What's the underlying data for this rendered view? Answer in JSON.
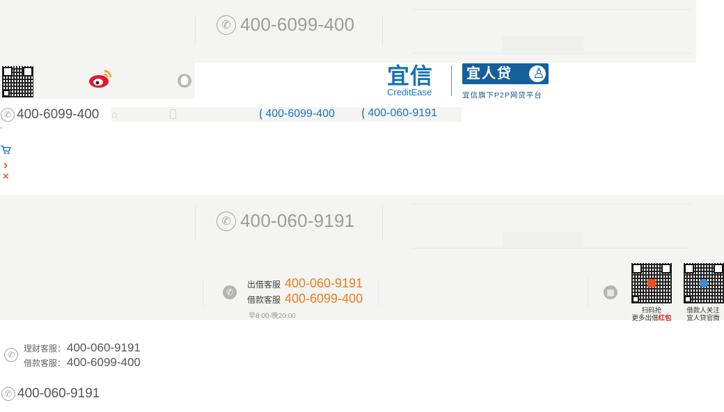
{
  "top_section": {
    "phone": "400-6099-400"
  },
  "social": {
    "qr_icon": "qr-code-icon",
    "weibo_icon": "weibo-icon",
    "qq_icon": "qq-icon"
  },
  "brand": {
    "creditease_cn": "宜信",
    "creditease_en": "CreditEase",
    "yirendai_name": "宜人贷",
    "yirendai_tagline": "宜信旗下P2P网贷平台"
  },
  "row3": {
    "phone_left": "400-6099-400",
    "phone_blue_1": "400-6099-400",
    "phone_blue_2": "400-060-9191"
  },
  "glyphs": {
    "cart": "🛒",
    "chevron": "›",
    "close": "×",
    "caret": "ˇ"
  },
  "middle_section": {
    "phone": "400-060-9191"
  },
  "service": {
    "lend_label": "出借客服",
    "lend_phone": "400-060-9191",
    "loan_label": "借款客服",
    "loan_phone": "400-6099-400",
    "hours": "早8:00-晚20:00",
    "qr1_caption_line1": "扫码抢",
    "qr1_caption_line2_pre": "更多出借",
    "qr1_caption_line2_red": "红包",
    "qr2_caption_line1": "借款人关注",
    "qr2_caption_line2": "宜人贷官微"
  },
  "footer_lines": {
    "finance_label": "理财客服：",
    "finance_phone": "400-060-9191",
    "loan_label": "借款客服：",
    "loan_phone": "400-6099-400",
    "single_phone": "400-060-9191"
  },
  "colors": {
    "brand_blue": "#1473bb",
    "accent_orange": "#f07b1c",
    "strip_grey": "#f4f4f2"
  }
}
